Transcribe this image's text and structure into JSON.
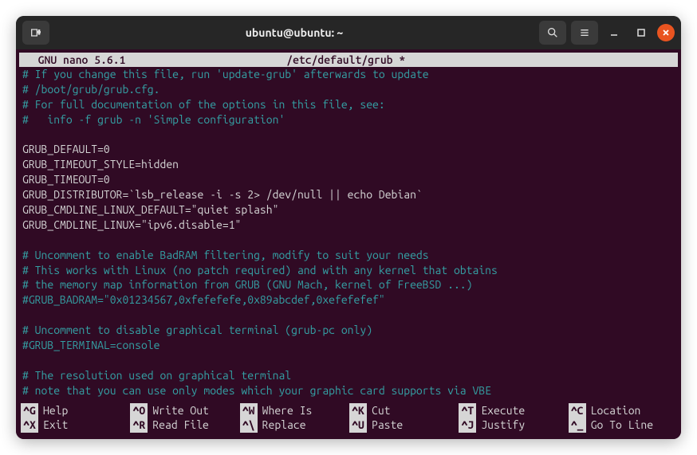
{
  "titlebar": {
    "title": "ubuntu@ubuntu: ~"
  },
  "nano_header": {
    "app": "  GNU nano 5.6.1",
    "file": "/etc/default/grub *"
  },
  "editor_lines": [
    {
      "t": "# If you change this file, run 'update-grub' afterwards to update",
      "c": "comment"
    },
    {
      "t": "# /boot/grub/grub.cfg.",
      "c": "comment"
    },
    {
      "t": "# For full documentation of the options in this file, see:",
      "c": "comment"
    },
    {
      "t": "#   info -f grub -n 'Simple configuration'",
      "c": "comment"
    },
    {
      "t": "",
      "c": ""
    },
    {
      "t": "GRUB_DEFAULT=0",
      "c": ""
    },
    {
      "t": "GRUB_TIMEOUT_STYLE=hidden",
      "c": ""
    },
    {
      "t": "GRUB_TIMEOUT=0",
      "c": ""
    },
    {
      "t": "GRUB_DISTRIBUTOR=`lsb_release -i -s 2> /dev/null || echo Debian`",
      "c": ""
    },
    {
      "t": "GRUB_CMDLINE_LINUX_DEFAULT=\"quiet splash\"",
      "c": ""
    },
    {
      "t": "GRUB_CMDLINE_LINUX=\"ipv6.disable=1\"",
      "c": ""
    },
    {
      "t": "",
      "c": ""
    },
    {
      "t": "# Uncomment to enable BadRAM filtering, modify to suit your needs",
      "c": "comment"
    },
    {
      "t": "# This works with Linux (no patch required) and with any kernel that obtains",
      "c": "comment"
    },
    {
      "t": "# the memory map information from GRUB (GNU Mach, kernel of FreeBSD ...)",
      "c": "comment"
    },
    {
      "t": "#GRUB_BADRAM=\"0x01234567,0xfefefefe,0x89abcdef,0xefefefef\"",
      "c": "comment"
    },
    {
      "t": "",
      "c": ""
    },
    {
      "t": "# Uncomment to disable graphical terminal (grub-pc only)",
      "c": "comment"
    },
    {
      "t": "#GRUB_TERMINAL=console",
      "c": "comment"
    },
    {
      "t": "",
      "c": ""
    },
    {
      "t": "# The resolution used on graphical terminal",
      "c": "comment"
    },
    {
      "t": "# note that you can use only modes which your graphic card supports via VBE",
      "c": "comment"
    }
  ],
  "shortcuts_row1": [
    {
      "key": "^G",
      "label": "Help"
    },
    {
      "key": "^O",
      "label": "Write Out"
    },
    {
      "key": "^W",
      "label": "Where Is"
    },
    {
      "key": "^K",
      "label": "Cut"
    },
    {
      "key": "^T",
      "label": "Execute"
    },
    {
      "key": "^C",
      "label": "Location"
    }
  ],
  "shortcuts_row2": [
    {
      "key": "^X",
      "label": "Exit"
    },
    {
      "key": "^R",
      "label": "Read File"
    },
    {
      "key": "^\\",
      "label": "Replace"
    },
    {
      "key": "^U",
      "label": "Paste"
    },
    {
      "key": "^J",
      "label": "Justify"
    },
    {
      "key": "^_",
      "label": "Go To Line"
    }
  ]
}
